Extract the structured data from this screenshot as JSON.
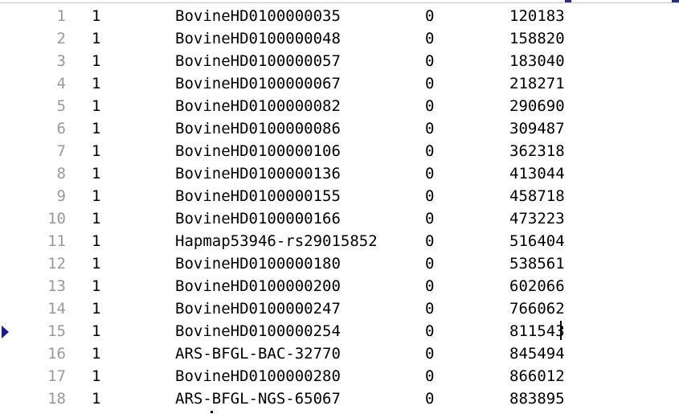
{
  "editor": {
    "caret_line": 15,
    "bookmark_line": 15,
    "lines": [
      {
        "num": "1",
        "chr": "1",
        "snp": "BovineHD0100000035",
        "cm": "0",
        "pos": "120183"
      },
      {
        "num": "2",
        "chr": "1",
        "snp": "BovineHD0100000048",
        "cm": "0",
        "pos": "158820"
      },
      {
        "num": "3",
        "chr": "1",
        "snp": "BovineHD0100000057",
        "cm": "0",
        "pos": "183040"
      },
      {
        "num": "4",
        "chr": "1",
        "snp": "BovineHD0100000067",
        "cm": "0",
        "pos": "218271"
      },
      {
        "num": "5",
        "chr": "1",
        "snp": "BovineHD0100000082",
        "cm": "0",
        "pos": "290690"
      },
      {
        "num": "6",
        "chr": "1",
        "snp": "BovineHD0100000086",
        "cm": "0",
        "pos": "309487"
      },
      {
        "num": "7",
        "chr": "1",
        "snp": "BovineHD0100000106",
        "cm": "0",
        "pos": "362318"
      },
      {
        "num": "8",
        "chr": "1",
        "snp": "BovineHD0100000136",
        "cm": "0",
        "pos": "413044"
      },
      {
        "num": "9",
        "chr": "1",
        "snp": "BovineHD0100000155",
        "cm": "0",
        "pos": "458718"
      },
      {
        "num": "10",
        "chr": "1",
        "snp": "BovineHD0100000166",
        "cm": "0",
        "pos": "473223"
      },
      {
        "num": "11",
        "chr": "1",
        "snp": "Hapmap53946-rs29015852",
        "cm": "0",
        "pos": "516404"
      },
      {
        "num": "12",
        "chr": "1",
        "snp": "BovineHD0100000180",
        "cm": "0",
        "pos": "538561"
      },
      {
        "num": "13",
        "chr": "1",
        "snp": "BovineHD0100000200",
        "cm": "0",
        "pos": "602066"
      },
      {
        "num": "14",
        "chr": "1",
        "snp": "BovineHD0100000247",
        "cm": "0",
        "pos": "766062"
      },
      {
        "num": "15",
        "chr": "1",
        "snp": "BovineHD0100000254",
        "cm": "0",
        "pos": "811543"
      },
      {
        "num": "16",
        "chr": "1",
        "snp": "ARS-BFGL-BAC-32770",
        "cm": "0",
        "pos": "845494"
      },
      {
        "num": "17",
        "chr": "1",
        "snp": "BovineHD0100000280",
        "cm": "0",
        "pos": "866012"
      },
      {
        "num": "18",
        "chr": "1",
        "snp": "ARS-BFGL-NGS-65067",
        "cm": "0",
        "pos": "883895"
      }
    ]
  }
}
